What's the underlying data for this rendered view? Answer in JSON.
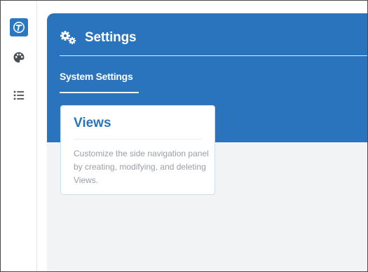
{
  "sidebar": {
    "items": [
      {
        "icon": "logo-t-icon"
      },
      {
        "icon": "palette-icon"
      },
      {
        "icon": "list-icon"
      }
    ]
  },
  "header": {
    "title": "Settings",
    "icon": "gears-icon"
  },
  "tabs": [
    {
      "label": "System Settings",
      "active": true
    }
  ],
  "cards": [
    {
      "title": "Views",
      "description": "Customize the side navigation panel by creating, modifying, and deleting Views."
    }
  ],
  "colors": {
    "brand": "#2a73bd",
    "background": "#f2f3f5",
    "card_border": "#c9e2f2",
    "muted_text": "#9a9ea4"
  }
}
